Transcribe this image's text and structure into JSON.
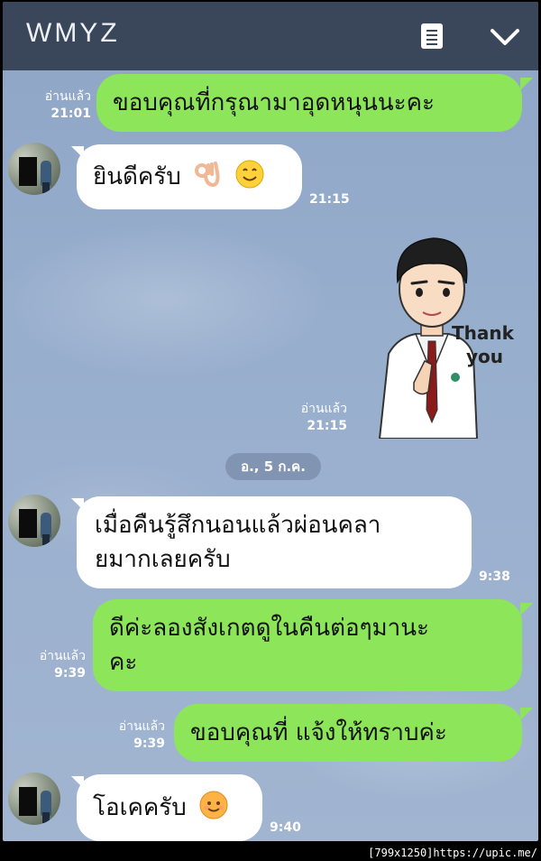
{
  "app": {
    "title": "WMYZ"
  },
  "header": {
    "notes_icon": "notes-icon",
    "collapse_icon": "chevron-down-icon"
  },
  "messages": [
    {
      "side": "out",
      "text": "ขอบคุณที่กรุณามาอุดหนุนนะคะ",
      "read": "อ่านแล้ว",
      "time": "21:01"
    },
    {
      "side": "in",
      "text": "ยินดีครับ",
      "emojis": [
        "ok-hand-emoji",
        "smiling-face-emoji"
      ],
      "time": "21:15"
    },
    {
      "side": "out",
      "type": "sticker",
      "sticker_text": "Thank you",
      "read": "อ่านแล้ว",
      "time": "21:15"
    },
    {
      "side": "in",
      "lines": [
        "เมื่อคืนรู้สึกนอนแล้วผ่อนคลา",
        "ยมากเลยครับ"
      ],
      "time": "9:38"
    },
    {
      "side": "out",
      "lines": [
        "ดีค่ะลองสังเกตดูในคืนต่อๆมานะ",
        "คะ"
      ],
      "read": "อ่านแล้ว",
      "time": "9:39"
    },
    {
      "side": "out",
      "text": "ขอบคุณที่ แจ้งให้ทราบค่ะ",
      "read": "อ่านแล้ว",
      "time": "9:39"
    },
    {
      "side": "in",
      "text": "โอเคครับ",
      "emojis": [
        "smiling-face-emoji"
      ],
      "time": "9:40"
    }
  ],
  "date_separator": "อ., 5 ก.ค.",
  "footer": {
    "size": "[799x1250]",
    "url": "https://upic.me/"
  },
  "colors": {
    "header": "#3a475b",
    "outgoing": "#8de55a",
    "incoming": "#ffffff",
    "background": "#98aecd"
  }
}
